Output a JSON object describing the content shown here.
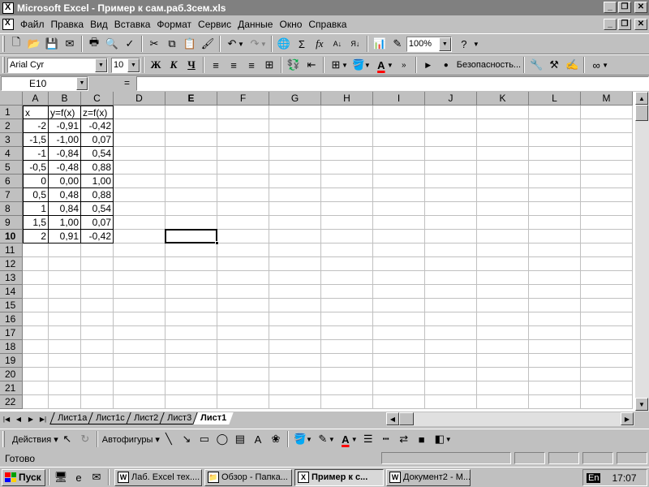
{
  "window": {
    "title": "Microsoft Excel - Пример к сам.раб.3сем.xls"
  },
  "menu": [
    "Файл",
    "Правка",
    "Вид",
    "Вставка",
    "Формат",
    "Сервис",
    "Данные",
    "Окно",
    "Справка"
  ],
  "toolbar": {
    "zoom": "100%",
    "font_name": "Arial Cyr",
    "font_size": "10",
    "bold_label": "Ж",
    "italic_label": "К",
    "underline_label": "Ч",
    "security_label": "Безопасность..."
  },
  "formula_bar": {
    "cell_ref": "E10",
    "equals": "=",
    "formula": ""
  },
  "grid": {
    "columns": [
      "A",
      "B",
      "C",
      "D",
      "E",
      "F",
      "G",
      "H",
      "I",
      "J",
      "K",
      "L",
      "M"
    ],
    "active_column": "E",
    "active_row": 10,
    "row_count": 22,
    "cells": [
      [
        "x",
        "y=f(x)",
        "z=f(x)"
      ],
      [
        "-2",
        "-0,91",
        "-0,42"
      ],
      [
        "-1,5",
        "-1,00",
        "0,07"
      ],
      [
        "-1",
        "-0,84",
        "0,54"
      ],
      [
        "-0,5",
        "-0,48",
        "0,88"
      ],
      [
        "0",
        "0,00",
        "1,00"
      ],
      [
        "0,5",
        "0,48",
        "0,88"
      ],
      [
        "1",
        "0,84",
        "0,54"
      ],
      [
        "1,5",
        "1,00",
        "0,07"
      ],
      [
        "2",
        "0,91",
        "-0,42"
      ]
    ]
  },
  "sheet_tabs": [
    "Лист1a",
    "Лист1c",
    "Лист2",
    "Лист3",
    "Лист1"
  ],
  "active_sheet": "Лист1",
  "drawing": {
    "actions_label": "Действия",
    "autoshapes_label": "Автофигуры"
  },
  "status": {
    "text": "Готово"
  },
  "taskbar": {
    "start_label": "Пуск",
    "tasks": [
      "Лаб. Excel тех....",
      "Обзор - Папка...",
      "Пример к с...",
      "Документ2 - М..."
    ],
    "active_task": 2,
    "lang": "En",
    "clock": "17:07"
  }
}
